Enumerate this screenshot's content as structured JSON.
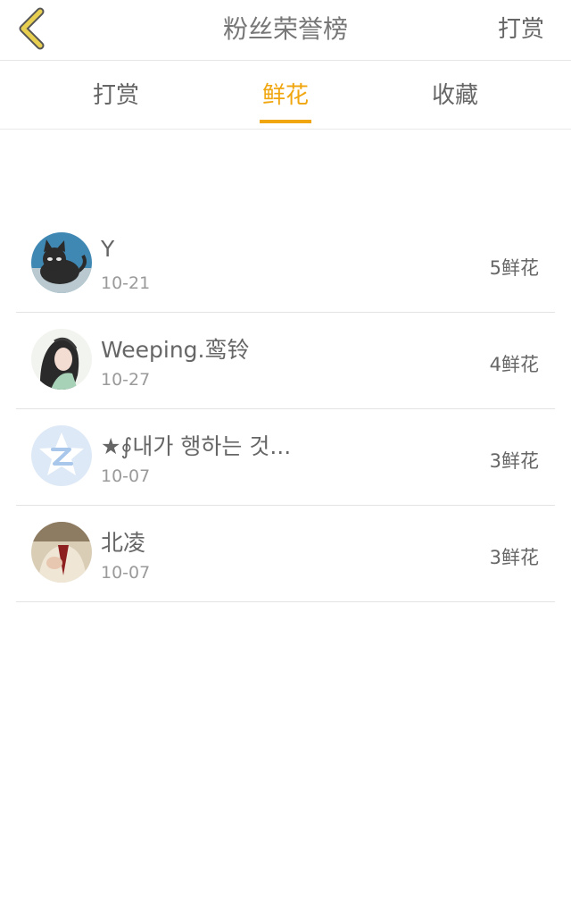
{
  "header": {
    "title": "粉丝荣誉榜",
    "action_label": "打赏",
    "back_icon": "chevron-left-icon"
  },
  "tabs": [
    {
      "label": "打赏",
      "active": false
    },
    {
      "label": "鲜花",
      "active": true
    },
    {
      "label": "收藏",
      "active": false
    }
  ],
  "colors": {
    "accent": "#f0a60f",
    "back_icon": "#e8cf4f",
    "text": "#666666",
    "date": "#9a9a9a",
    "divider": "#e3e3e3"
  },
  "fans": [
    {
      "name": "Y",
      "date": "10-21",
      "count": "5鲜花",
      "avatar": "cat-avatar"
    },
    {
      "name": "Weeping.鸾铃",
      "date": "10-27",
      "count": "4鲜花",
      "avatar": "girl-avatar"
    },
    {
      "name": "★∮내가 행하는 것...",
      "date": "10-07",
      "count": "3鲜花",
      "avatar": "qzone-star-avatar"
    },
    {
      "name": "北凌",
      "date": "10-07",
      "count": "3鲜花",
      "avatar": "portrait-avatar"
    }
  ]
}
